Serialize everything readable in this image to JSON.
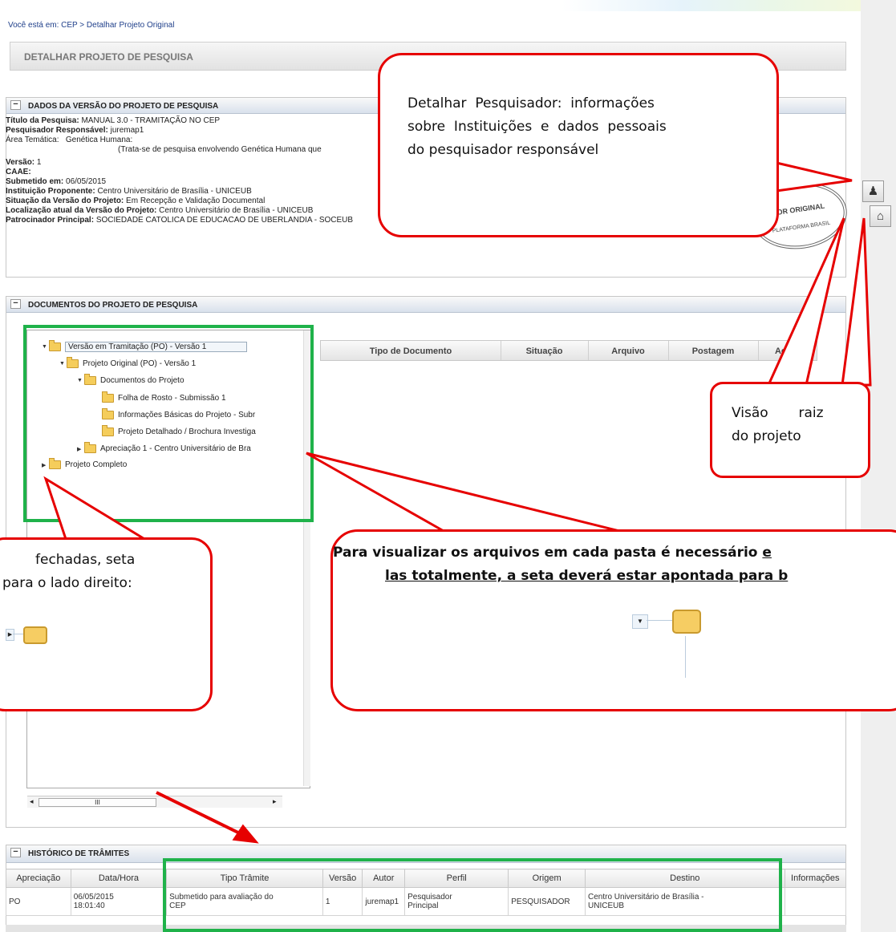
{
  "breadcrumb": "Você está em: CEP > Detalhar Projeto Original",
  "page_title": "DETALHAR PROJETO DE PESQUISA",
  "version_panel": {
    "header": "DADOS DA VERSÃO DO PROJETO DE PESQUISA",
    "titulo_label": "Título da Pesquisa:",
    "titulo_value": "MANUAL 3.0 - TRAMITAÇÃO NO CEP",
    "pesquisador_label": "Pesquisador Responsável:",
    "pesquisador_value": "juremap1",
    "area_label": "Área Temática:",
    "area_value": "Genética Humana:",
    "area_note": "(Trata-se de pesquisa envolvendo Genética Humana que",
    "versao_label": "Versão:",
    "versao_value": "1",
    "caae_label": "CAAE:",
    "submetido_label": "Submetido em:",
    "submetido_value": "06/05/2015",
    "instituicao_label": "Instituição Proponente:",
    "instituicao_value": "Centro Universitário de Brasília - UNICEUB",
    "situacao_label": "Situação da Versão do Projeto:",
    "situacao_value": "Em Recepção e Validação Documental",
    "localizacao_label": "Localização atual da Versão do Projeto:",
    "localizacao_value": "Centro Universitário de Brasília - UNICEUB",
    "patrocinador_label": "Patrocinador Principal:",
    "patrocinador_value": "SOCIEDADE CATOLICA DE EDUCACAO DE UBERLANDIA - SOCEUB",
    "stamp_text": "JOR ORIGINAL",
    "stamp_subtext": "PLATAFORMA BRASIL"
  },
  "documents_panel": {
    "header": "DOCUMENTOS DO PROJETO DE PESQUISA",
    "tree": [
      "Versão em Tramitação (PO) - Versão 1",
      "Projeto Original (PO) - Versão 1",
      "Documentos do Projeto",
      "Folha de Rosto - Submissão 1",
      "Informações Básicas do Projeto - Subr",
      "Projeto Detalhado / Brochura Investiga",
      "Apreciação 1 - Centro Universitário de Bra",
      "Projeto Completo"
    ],
    "columns": [
      "Tipo de Documento",
      "Situação",
      "Arquivo",
      "Postagem",
      "Ações"
    ],
    "scroll_marker": "III"
  },
  "history_panel": {
    "header": "HISTÓRICO DE TRÂMITES",
    "columns": [
      "Apreciação",
      "Data/Hora",
      "Tipo Trâmite",
      "Versão",
      "Autor",
      "Perfil",
      "Origem",
      "Destino",
      "Informações"
    ],
    "rows": [
      {
        "apreciacao": "PO",
        "data": "06/05/2015",
        "hora": "18:01:40",
        "tipo_1": "Submetido para avaliação do",
        "tipo_2": "CEP",
        "versao": "1",
        "autor": "juremap1",
        "perfil_1": "Pesquisador",
        "perfil_2": "Principal",
        "origem": "PESQUISADOR",
        "destino_1": "Centro Universitário de Brasília -",
        "destino_2": "UNICEUB",
        "informacoes": ""
      }
    ]
  },
  "callouts": {
    "pesquisador_1": "Detalhar  Pesquisador:  informações",
    "pesquisador_2": "sobre  Instituições  e  dados  pessoais",
    "pesquisador_3": "do pesquisador responsável",
    "raiz_1": "Visão       raiz",
    "raiz_2": "do projeto",
    "fechadas_1": "fechadas, seta",
    "fechadas_2": "para o lado direito:",
    "visualizar_1_bold": "Para visualizar os arquivos em cada pasta é necessário ",
    "visualizar_1_underline": "e",
    "visualizar_2": "las totalmente, a seta deverá estar apontada para b"
  },
  "colors": {
    "callout_border": "#e60000",
    "highlight_green": "#1fb24a",
    "panel_header": "#d9e1ec"
  },
  "icons": {
    "side_pesquisador": "person-icon",
    "side_home": "home-icon"
  }
}
